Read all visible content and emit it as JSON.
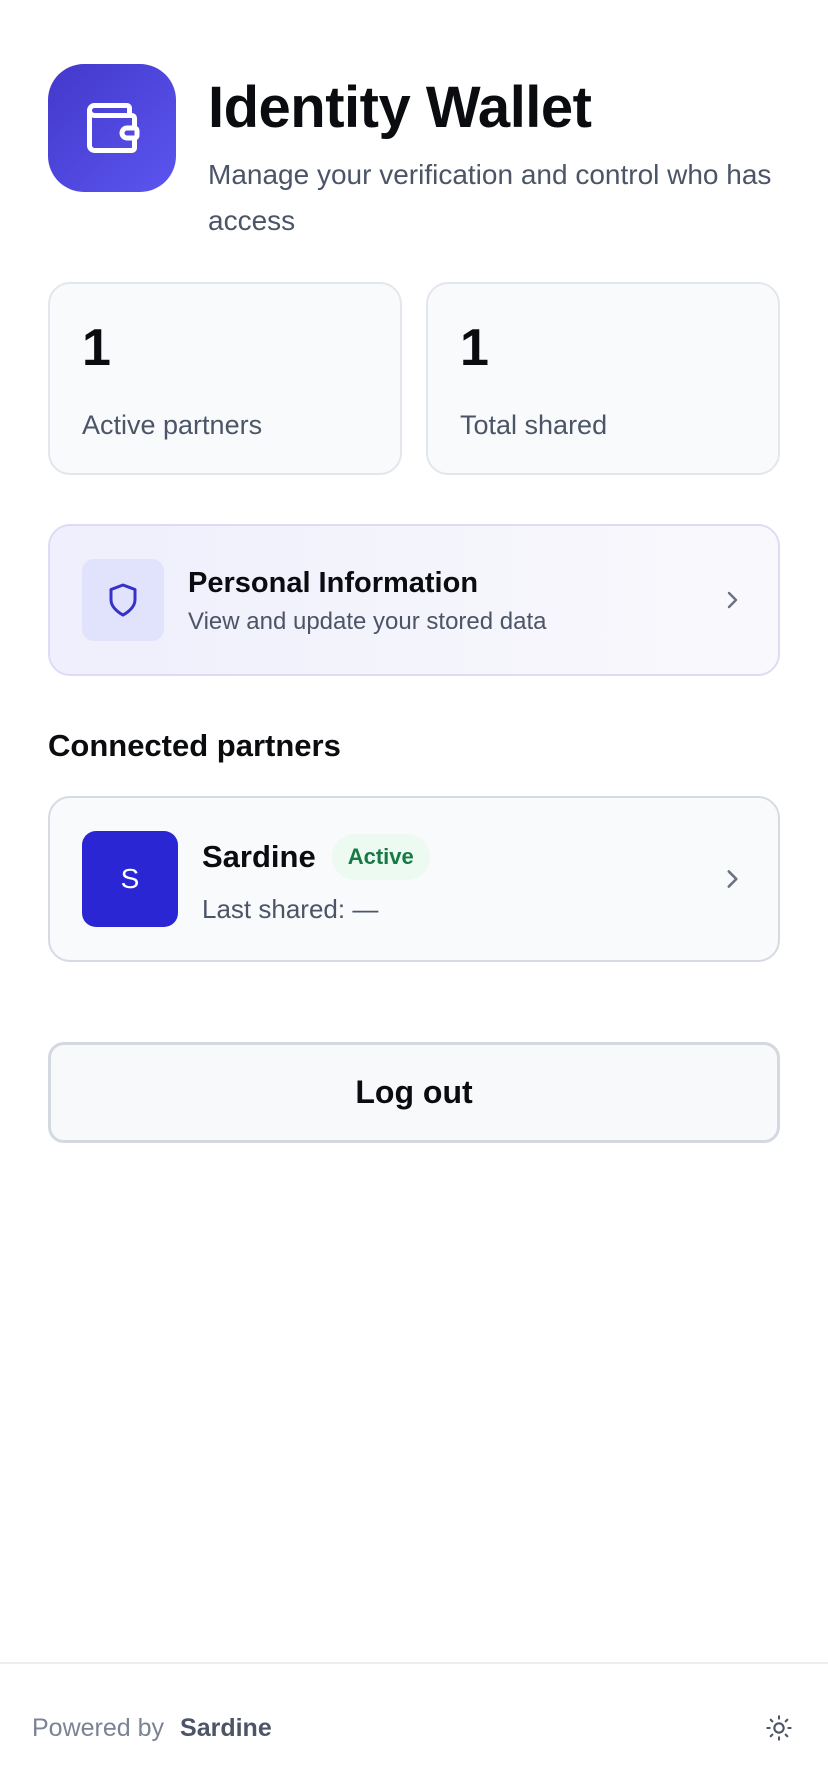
{
  "header": {
    "title": "Identity Wallet",
    "subtitle": "Manage your verification and control who has access",
    "icon": "wallet-icon",
    "accent_color": "#4f46e5"
  },
  "stats": [
    {
      "value": "1",
      "label": "Active partners"
    },
    {
      "value": "1",
      "label": "Total shared"
    }
  ],
  "personal_info": {
    "title": "Personal Information",
    "subtitle": "View and update your stored data",
    "icon": "shield-icon"
  },
  "connected_partners": {
    "heading": "Connected partners",
    "items": [
      {
        "initial": "S",
        "name": "Sardine",
        "status": "Active",
        "last_shared": "Last shared: —",
        "avatar_color": "#2a26d4",
        "status_color": "#177a46"
      }
    ]
  },
  "logout_label": "Log out",
  "footer": {
    "powered_by": "Powered by",
    "brand": "Sardine",
    "theme_icon": "sun-icon"
  }
}
